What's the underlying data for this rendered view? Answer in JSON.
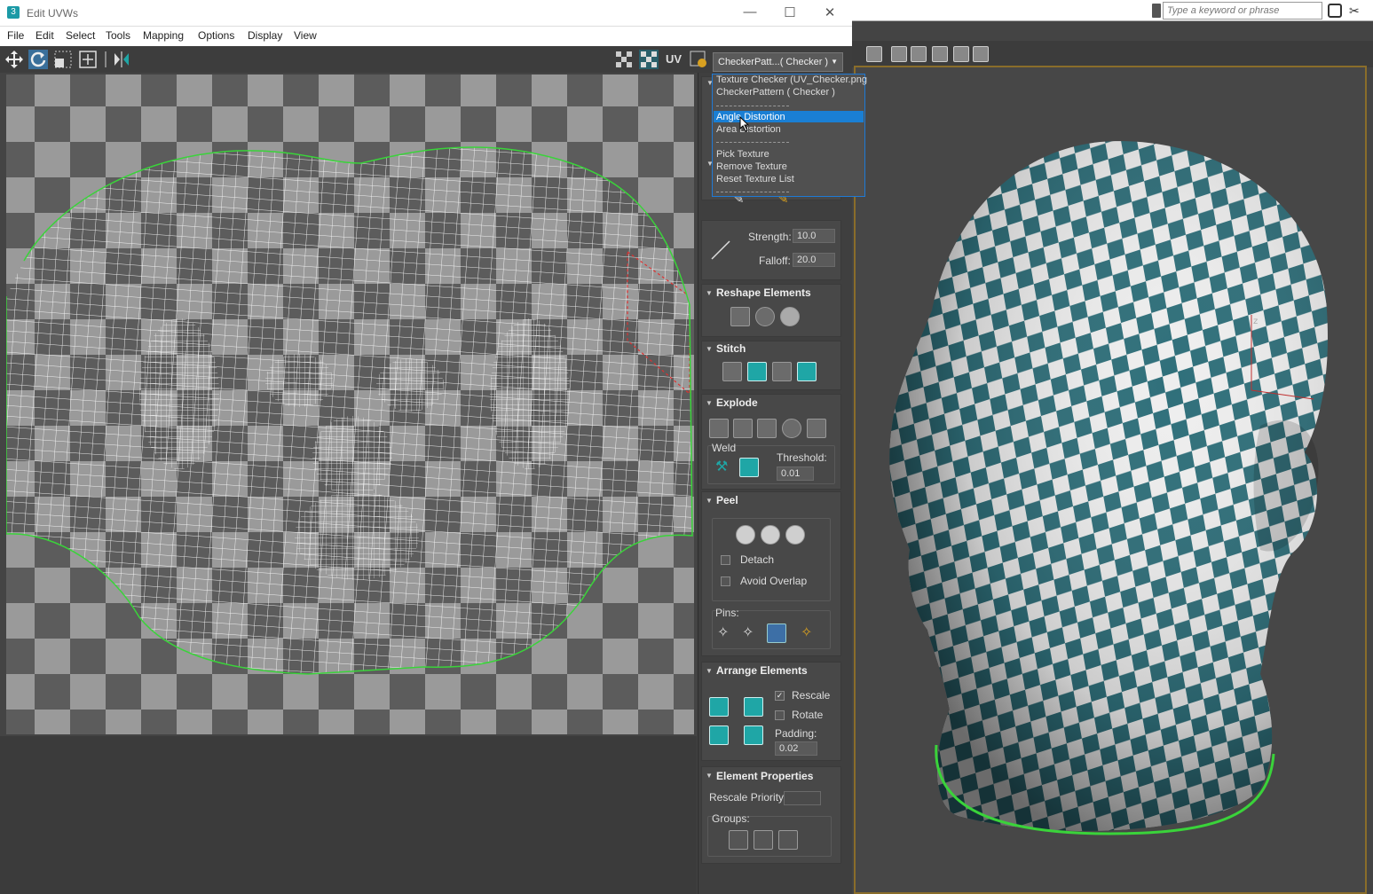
{
  "window": {
    "app_icon": "3",
    "title": "Edit UVWs",
    "min_label": "—",
    "max_label": "☐",
    "close_label": "✕"
  },
  "menu": [
    "File",
    "Edit",
    "Select",
    "Tools",
    "Mapping",
    "Options",
    "Display",
    "View"
  ],
  "toolbar": {
    "uv_label": "UV",
    "texture_dropdown": "CheckerPatt...( Checker )"
  },
  "texture_menu": {
    "items": [
      "Texture Checker (UV_Checker.png",
      "CheckerPattern  ( Checker )",
      "Angle Distortion",
      "Area Distortion",
      "Pick Texture",
      "Remove Texture",
      "Reset Texture List"
    ],
    "selected": "Angle Distortion",
    "colors": {
      "highlight": "#1a7fd4"
    }
  },
  "paint": {
    "strength_label": "Strength:",
    "strength_value": "10.0",
    "falloff_label": "Falloff:",
    "falloff_value": "20.0"
  },
  "reshape": {
    "title": "Reshape Elements"
  },
  "stitch": {
    "title": "Stitch"
  },
  "explode": {
    "title": "Explode",
    "weld_label": "Weld",
    "threshold_label": "Threshold:",
    "threshold_value": "0.01"
  },
  "peel": {
    "title": "Peel",
    "detach_label": "Detach",
    "avoid_overlap_label": "Avoid Overlap",
    "pins_label": "Pins:"
  },
  "arrange": {
    "title": "Arrange Elements",
    "rescale_label": "Rescale",
    "rescale_checked": "✓",
    "rotate_label": "Rotate",
    "padding_label": "Padding:",
    "padding_value": "0.02"
  },
  "element_props": {
    "title": "Element Properties",
    "rescale_priority_label": "Rescale Priority:",
    "groups_label": "Groups:"
  },
  "search": {
    "placeholder": "Type a keyword or phrase"
  },
  "colors": {
    "checker_teal": "#2f6f7a",
    "uv_seam": "#3ad33a",
    "accent_blue": "#1a7fd4"
  }
}
